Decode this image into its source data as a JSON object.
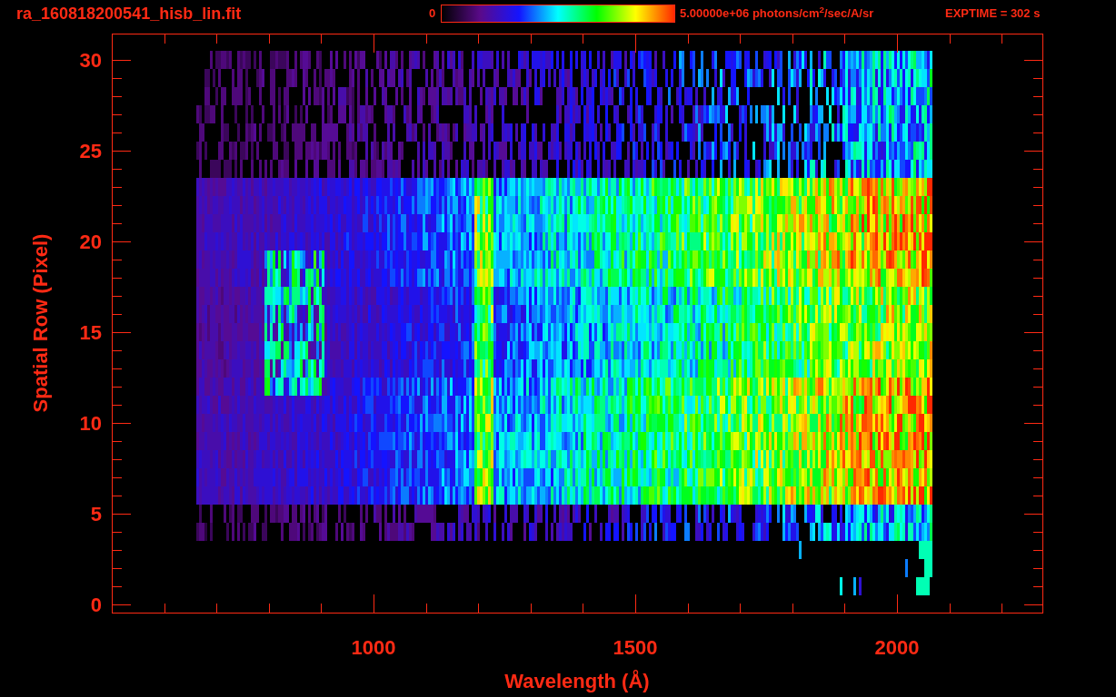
{
  "header": {
    "title": "ra_160818200541_hisb_lin.fit",
    "colorbar": {
      "min_label": "0",
      "max_label": "5.00000e+06 photons/cm$^{2}$/sec/A/sr"
    },
    "exposure": "EXPTIME = 302 s"
  },
  "plot": {
    "y_axis": {
      "title": "Spatial Row (Pixel)",
      "tick_labels": [
        "30",
        "25",
        "20",
        "15",
        "10",
        "5",
        "0"
      ]
    },
    "x_axis": {
      "title": "Wavelength (Å)",
      "tick_labels": [
        "1000",
        "1500",
        "2000"
      ]
    }
  }
}
